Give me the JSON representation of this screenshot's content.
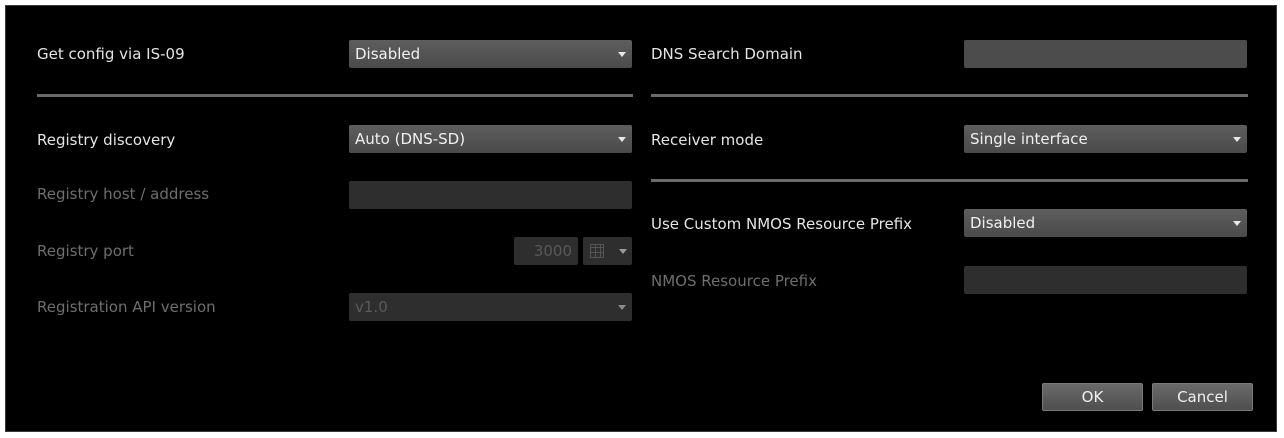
{
  "left": {
    "is09": {
      "label": "Get config via IS-09",
      "value": "Disabled"
    },
    "registry_discovery": {
      "label": "Registry discovery",
      "value": "Auto (DNS-SD)"
    },
    "registry_host": {
      "label": "Registry host / address",
      "value": ""
    },
    "registry_port": {
      "label": "Registry port",
      "value": "3000"
    },
    "registration_api": {
      "label": "Registration API version",
      "value": "v1.0"
    }
  },
  "right": {
    "dns_search_domain": {
      "label": "DNS Search Domain",
      "value": ""
    },
    "receiver_mode": {
      "label": "Receiver mode",
      "value": "Single interface"
    },
    "custom_prefix": {
      "label": "Use Custom NMOS Resource Prefix",
      "value": "Disabled"
    },
    "resource_prefix": {
      "label": "NMOS Resource Prefix",
      "value": ""
    }
  },
  "buttons": {
    "ok": "OK",
    "cancel": "Cancel"
  },
  "icons": {
    "dropdown": "chevron-down-icon",
    "grid": "grid-icon"
  }
}
